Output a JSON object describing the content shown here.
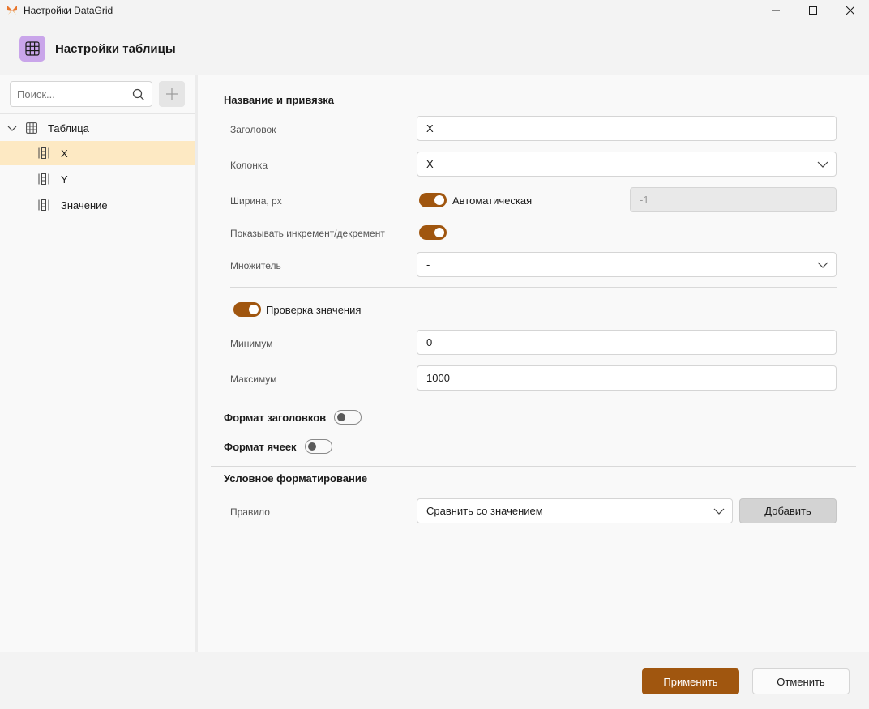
{
  "window": {
    "title": "Настройки DataGrid",
    "app_icon": "butterfly-logo-icon",
    "accent_color": "#a0560f"
  },
  "header": {
    "title": "Настройки таблицы",
    "icon": "table-grid-icon"
  },
  "sidebar": {
    "search": {
      "placeholder": "Поиск...",
      "value": ""
    },
    "tree": {
      "root": {
        "label": "Таблица",
        "icon": "table-grid-icon",
        "expanded": true
      },
      "items": [
        {
          "label": "X",
          "icon": "column-icon",
          "selected": true
        },
        {
          "label": "Y",
          "icon": "column-icon",
          "selected": false
        },
        {
          "label": "Значение",
          "icon": "column-icon",
          "selected": false
        }
      ]
    }
  },
  "main": {
    "binding": {
      "title": "Название и привязка",
      "header_label": "Заголовок",
      "header_value": "X",
      "column_label": "Колонка",
      "column_value": "X",
      "width_label": "Ширина, px",
      "width_auto_label": "Автоматическая",
      "width_auto_on": true,
      "width_value": "-1",
      "show_inc_label": "Показывать инкремент/декремент",
      "show_inc_on": true,
      "multiplier_label": "Множитель",
      "multiplier_value": "-"
    },
    "validation": {
      "label": "Проверка значения",
      "on": true,
      "min_label": "Минимум",
      "min_value": "0",
      "max_label": "Максимум",
      "max_value": "1000"
    },
    "header_format": {
      "label": "Формат заголовков",
      "on": false
    },
    "cell_format": {
      "label": "Формат ячеек",
      "on": false
    },
    "conditional": {
      "title": "Условное форматирование",
      "rule_label": "Правило",
      "rule_value": "Сравнить со значением",
      "add_label": "Добавить"
    }
  },
  "footer": {
    "apply_label": "Применить",
    "cancel_label": "Отменить"
  }
}
